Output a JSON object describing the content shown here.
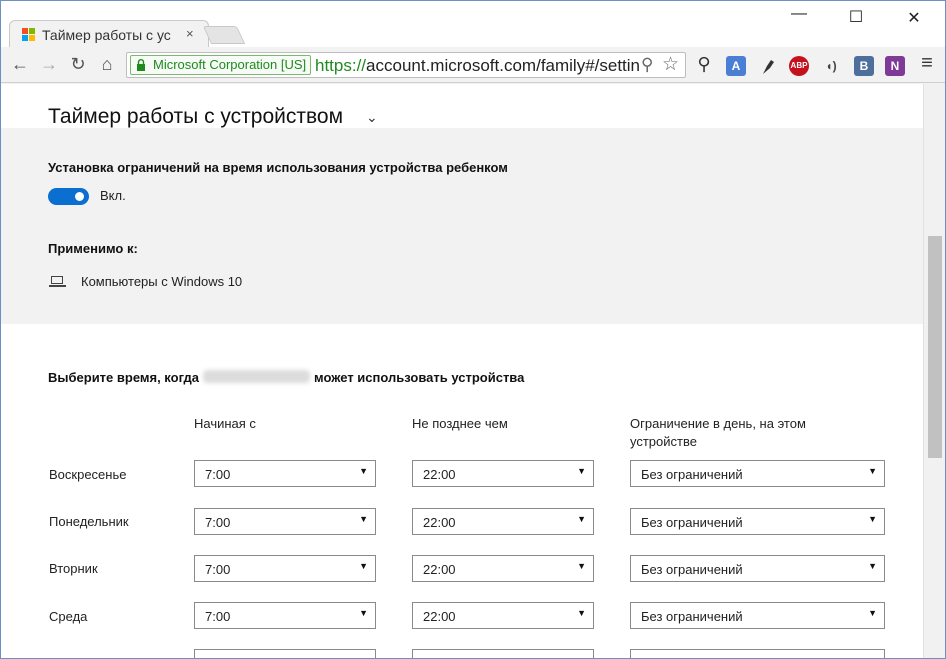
{
  "browser": {
    "tab_title": "Таймер работы с ус",
    "tab_close": "×",
    "window_controls": {
      "minimize": "—",
      "maximize": "☐",
      "close": "✕"
    },
    "ev_badge": "Microsoft Corporation [US]",
    "url_scheme": "https://",
    "url_rest": "account.microsoft.com/family#/setting",
    "icons": {
      "back": "←",
      "forward": "→",
      "reload": "↻",
      "home": "⌂",
      "zoom": "⚲",
      "star": "☆",
      "search": "⚲",
      "menu": "≡"
    },
    "extensions": {
      "translate": "A",
      "abp": "ABP",
      "audio": "◖)",
      "vk": "B",
      "onenote": "N"
    }
  },
  "page": {
    "title": "Таймер работы с устройством",
    "title_chevron": "⌄",
    "limits_heading": "Установка ограничений на время использования устройства ребенком",
    "toggle_label": "Вкл.",
    "applies_heading": "Применимо к:",
    "applies_device": "Компьютеры с Windows 10",
    "choose_prefix": "Выберите время, когда",
    "choose_suffix": "может использовать устройства",
    "columns": {
      "start": "Начиная с",
      "end": "Не позднее чем",
      "limit_line1": "Ограничение в день, на этом",
      "limit_line2": "устройстве"
    },
    "rows": [
      {
        "day": "Воскресенье",
        "start": "7:00",
        "end": "22:00",
        "limit": "Без ограничений"
      },
      {
        "day": "Понедельник",
        "start": "7:00",
        "end": "22:00",
        "limit": "Без ограничений"
      },
      {
        "day": "Вторник",
        "start": "7:00",
        "end": "22:00",
        "limit": "Без ограничений"
      },
      {
        "day": "Среда",
        "start": "7:00",
        "end": "22:00",
        "limit": "Без ограничений"
      }
    ],
    "select_arrow": "▼"
  }
}
